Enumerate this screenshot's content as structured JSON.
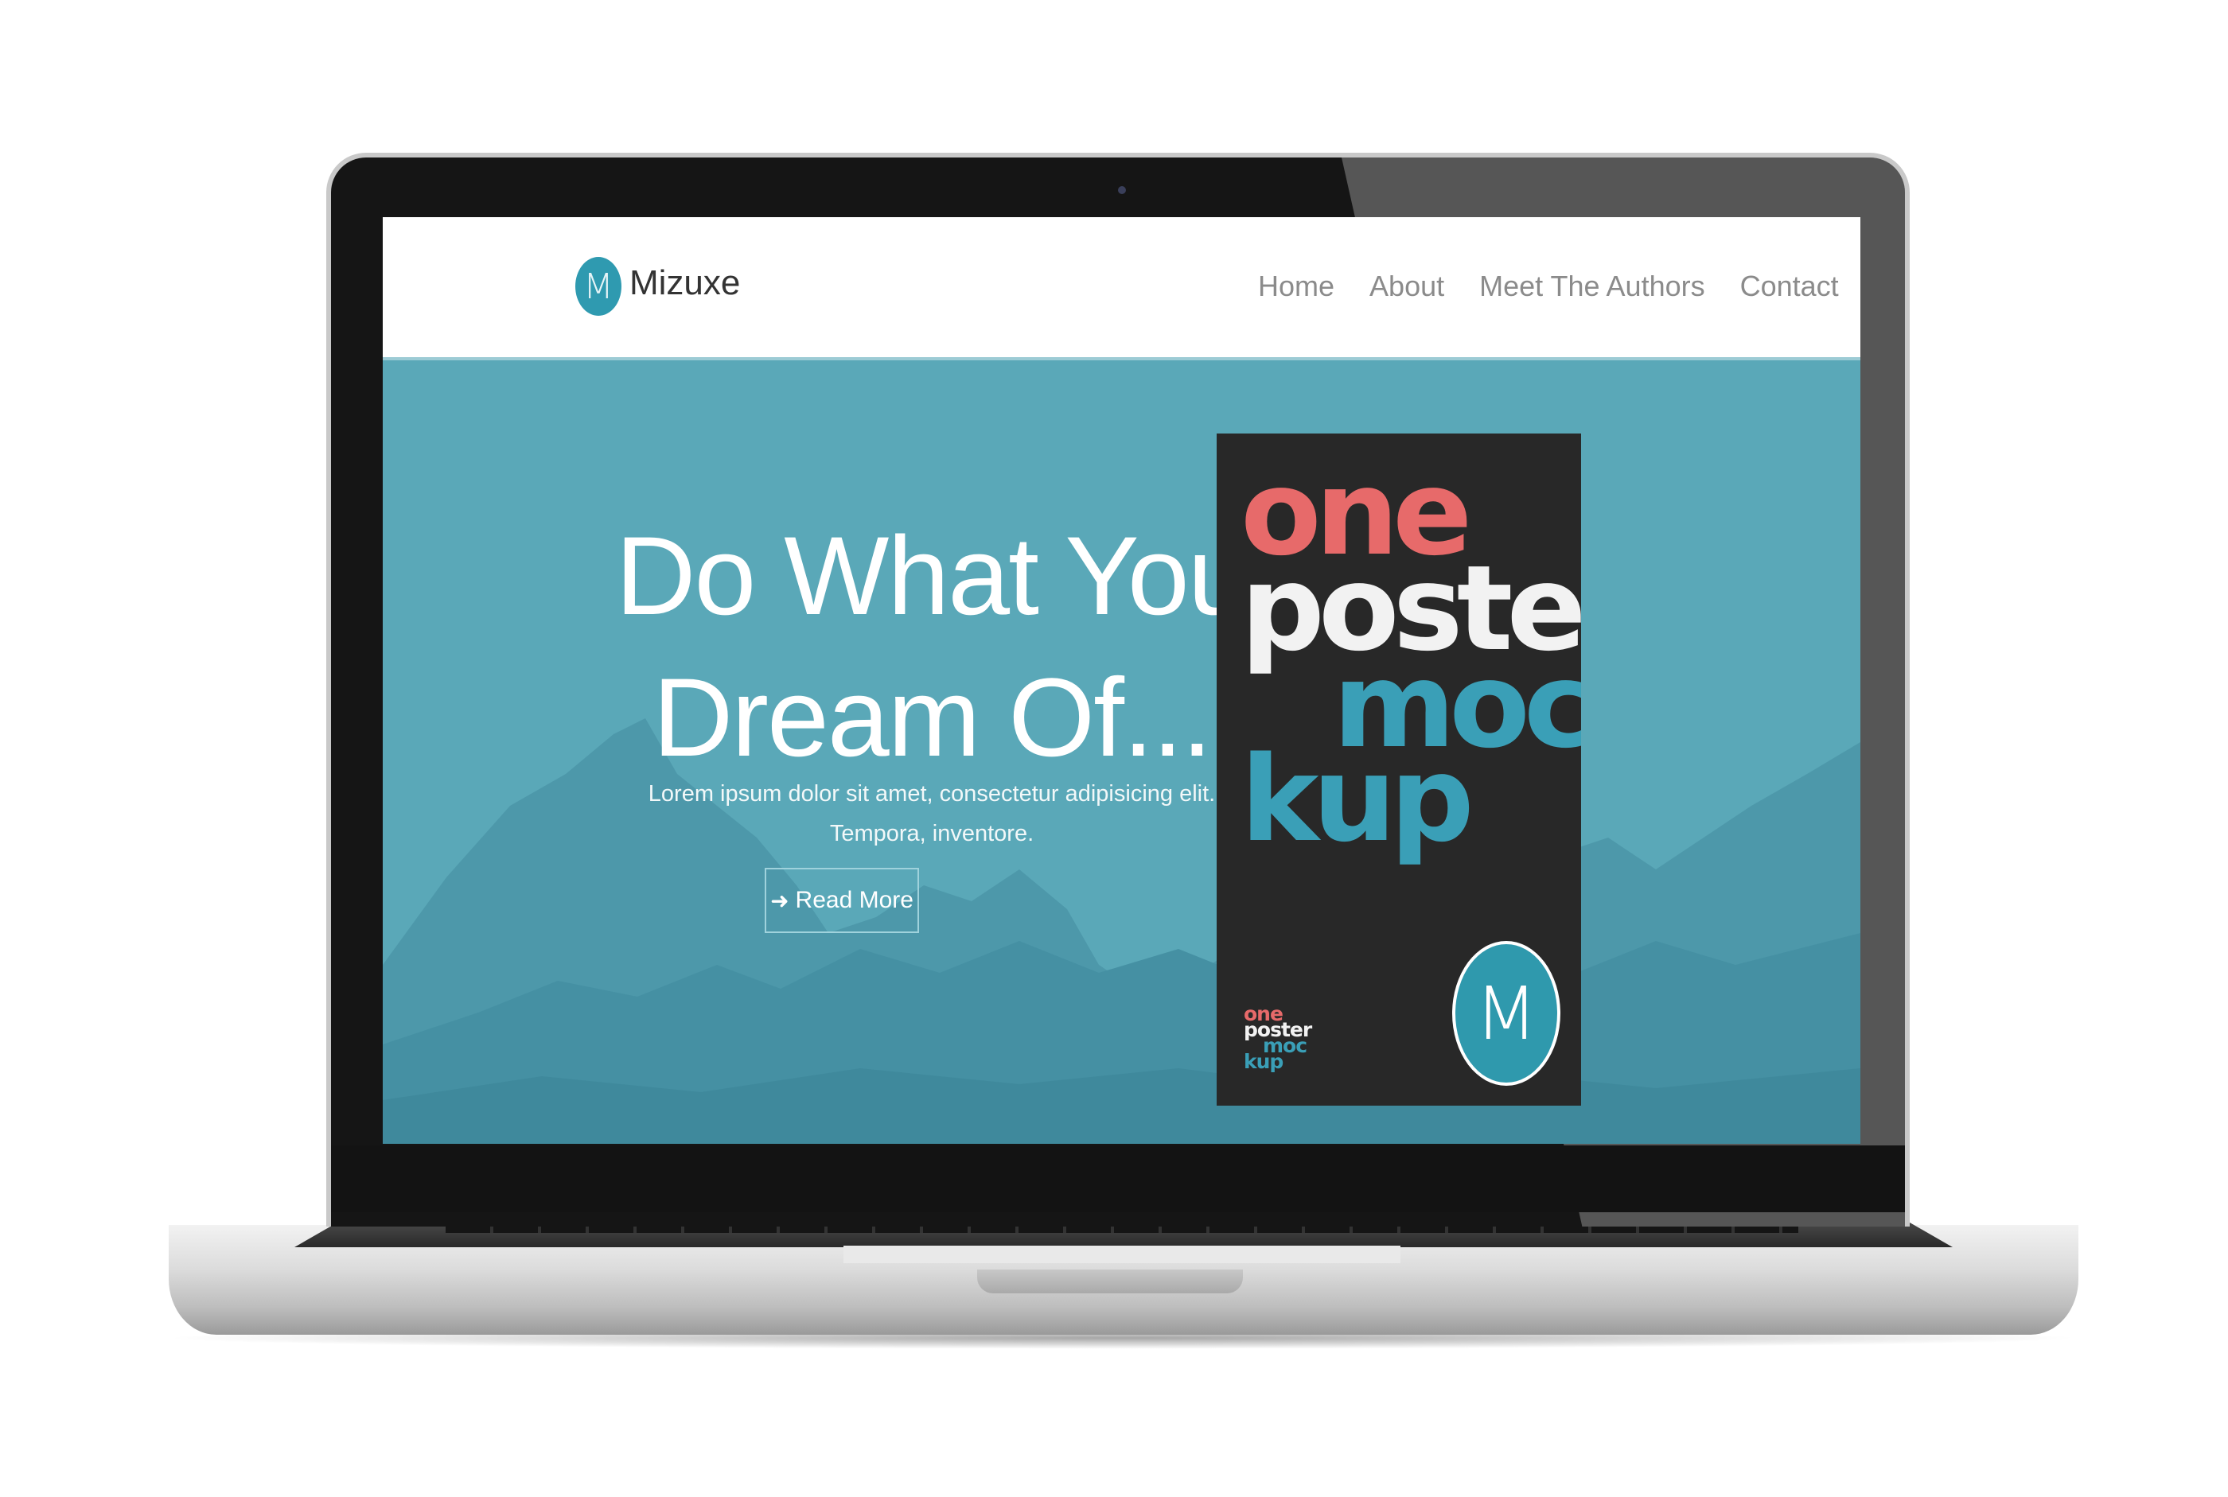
{
  "navbar": {
    "brand": {
      "logo_letter": "M",
      "name": "Mizuxe"
    },
    "links": [
      "Home",
      "About",
      "Meet The Authors",
      "Contact"
    ]
  },
  "hero": {
    "headline_line1": "Do What You",
    "headline_line2": "Dream Of...",
    "subtext_line1": "Lorem ipsum dolor sit amet, consectetur adipisicing elit.",
    "subtext_line2": "Tempora, inventore.",
    "button_label": "Read More",
    "button_icon": "arrow-right-icon"
  },
  "poster": {
    "words": [
      "one",
      "poster",
      "moc",
      "kup"
    ],
    "logo_letter": "M"
  },
  "colors": {
    "accent": "#2f9ab0",
    "hero_background": "#5aa8b8",
    "poster_background": "#282828",
    "poster_red": "#e76a6a",
    "poster_teal": "#3a9fb7"
  }
}
